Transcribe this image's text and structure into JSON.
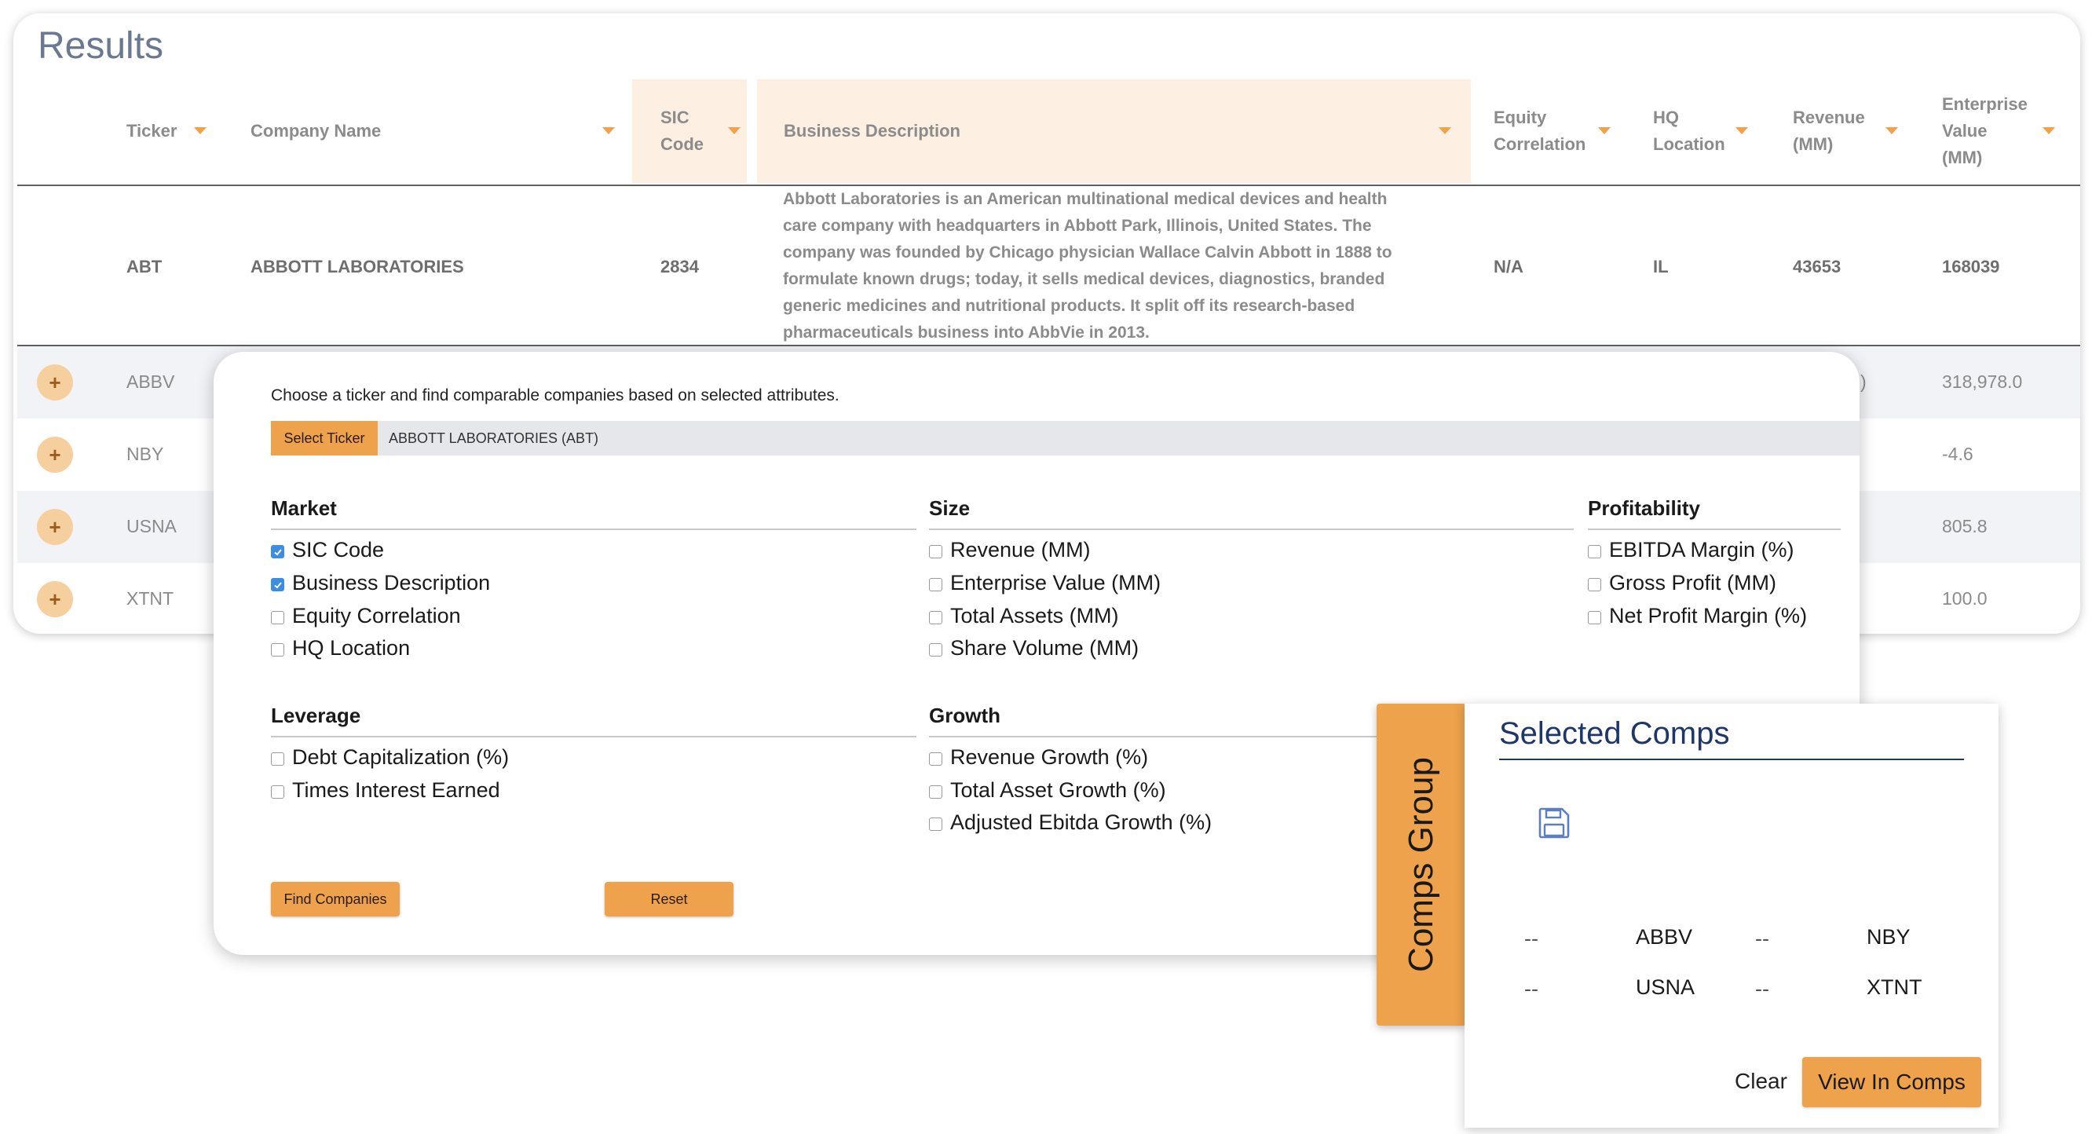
{
  "results": {
    "title": "Results",
    "columns": [
      "Ticker",
      "Company Name",
      "SIC\nCode",
      "Business Description",
      "Equity\nCorrelation",
      "HQ\nLocation",
      "Revenue\n(MM)",
      "Enterprise\nValue\n(MM)"
    ],
    "target_row": {
      "ticker": "ABT",
      "company": "ABBOTT LABORATORIES",
      "sic": "2834",
      "description": "Abbott Laboratories is an American multinational medical devices and health care company with headquarters in Abbott Park, Illinois, United States. The company was founded by Chicago physician Wallace Calvin Abbott in 1888 to formulate known drugs; today, it sells medical devices, diagnostics, branded generic medicines and nutritional products. It split off its research-based pharmaceuticals business into AbbVie in 2013.",
      "equity_correlation": "N/A",
      "hq": "IL",
      "revenue": "43653",
      "enterprise_value": "168039"
    },
    "comp_rows": [
      {
        "ticker": "ABBV",
        "enterprise_value": "318,978.0",
        "partial": ")"
      },
      {
        "ticker": "NBY",
        "enterprise_value": "-4.6"
      },
      {
        "ticker": "USNA",
        "enterprise_value": "805.8"
      },
      {
        "ticker": "XTNT",
        "enterprise_value": "100.0"
      }
    ],
    "add_symbol": "+"
  },
  "finder": {
    "intro": "Choose a ticker and find comparable companies based on selected attributes.",
    "select_ticker_label": "Select Ticker",
    "selected_ticker": "ABBOTT LABORATORIES (ABT)",
    "groups": {
      "market": {
        "title": "Market",
        "options": [
          {
            "label": "SIC Code",
            "checked": true
          },
          {
            "label": "Business Description",
            "checked": true
          },
          {
            "label": "Equity Correlation",
            "checked": false
          },
          {
            "label": "HQ Location",
            "checked": false
          }
        ]
      },
      "size": {
        "title": "Size",
        "options": [
          {
            "label": "Revenue (MM)",
            "checked": false
          },
          {
            "label": "Enterprise Value (MM)",
            "checked": false
          },
          {
            "label": "Total Assets (MM)",
            "checked": false
          },
          {
            "label": "Share Volume (MM)",
            "checked": false
          }
        ]
      },
      "profitability": {
        "title": "Profitability",
        "options": [
          {
            "label": "EBITDA Margin (%)",
            "checked": false
          },
          {
            "label": "Gross Profit (MM)",
            "checked": false
          },
          {
            "label": "Net Profit Margin (%)",
            "checked": false
          }
        ]
      },
      "leverage": {
        "title": "Leverage",
        "options": [
          {
            "label": "Debt Capitalization (%)",
            "checked": false
          },
          {
            "label": "Times Interest Earned",
            "checked": false
          }
        ]
      },
      "growth": {
        "title": "Growth",
        "options": [
          {
            "label": "Revenue Growth (%)",
            "checked": false
          },
          {
            "label": "Total Asset Growth (%)",
            "checked": false
          },
          {
            "label": "Adjusted Ebitda Growth (%)",
            "checked": false
          }
        ]
      }
    },
    "find_button": "Find Companies",
    "reset_button": "Reset"
  },
  "comps": {
    "tab_label": "Comps Group",
    "title": "Selected Comps",
    "icon": "save-icon",
    "dash": "--",
    "items": [
      "ABBV",
      "NBY",
      "USNA",
      "XTNT"
    ],
    "clear_button": "Clear",
    "view_button": "View In Comps"
  },
  "colors": {
    "accent": "#eea24b",
    "header_highlight": "#fdf0e2",
    "navy": "#1f3668",
    "checkbox_checked": "#3d8de0"
  }
}
